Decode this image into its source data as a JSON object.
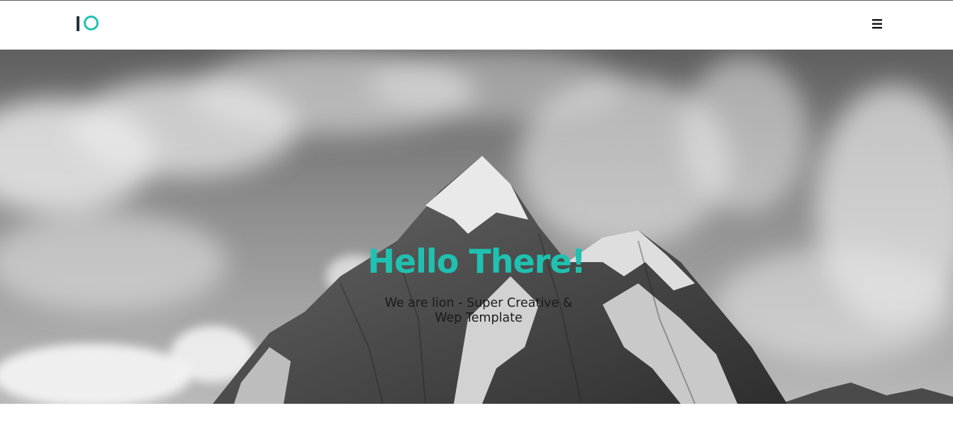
{
  "header": {
    "logo_icon": "io-logo-icon",
    "menu_icon": "hamburger-menu-icon"
  },
  "hero": {
    "title": "Hello There!",
    "subtitle": "We are lion - Super Creative & Wep Template",
    "background": "grayscale snowy mountain peak under clouds"
  },
  "colors": {
    "accent": "#1fc1b0",
    "logo_dark": "#263238",
    "header_bg": "#ffffff"
  }
}
